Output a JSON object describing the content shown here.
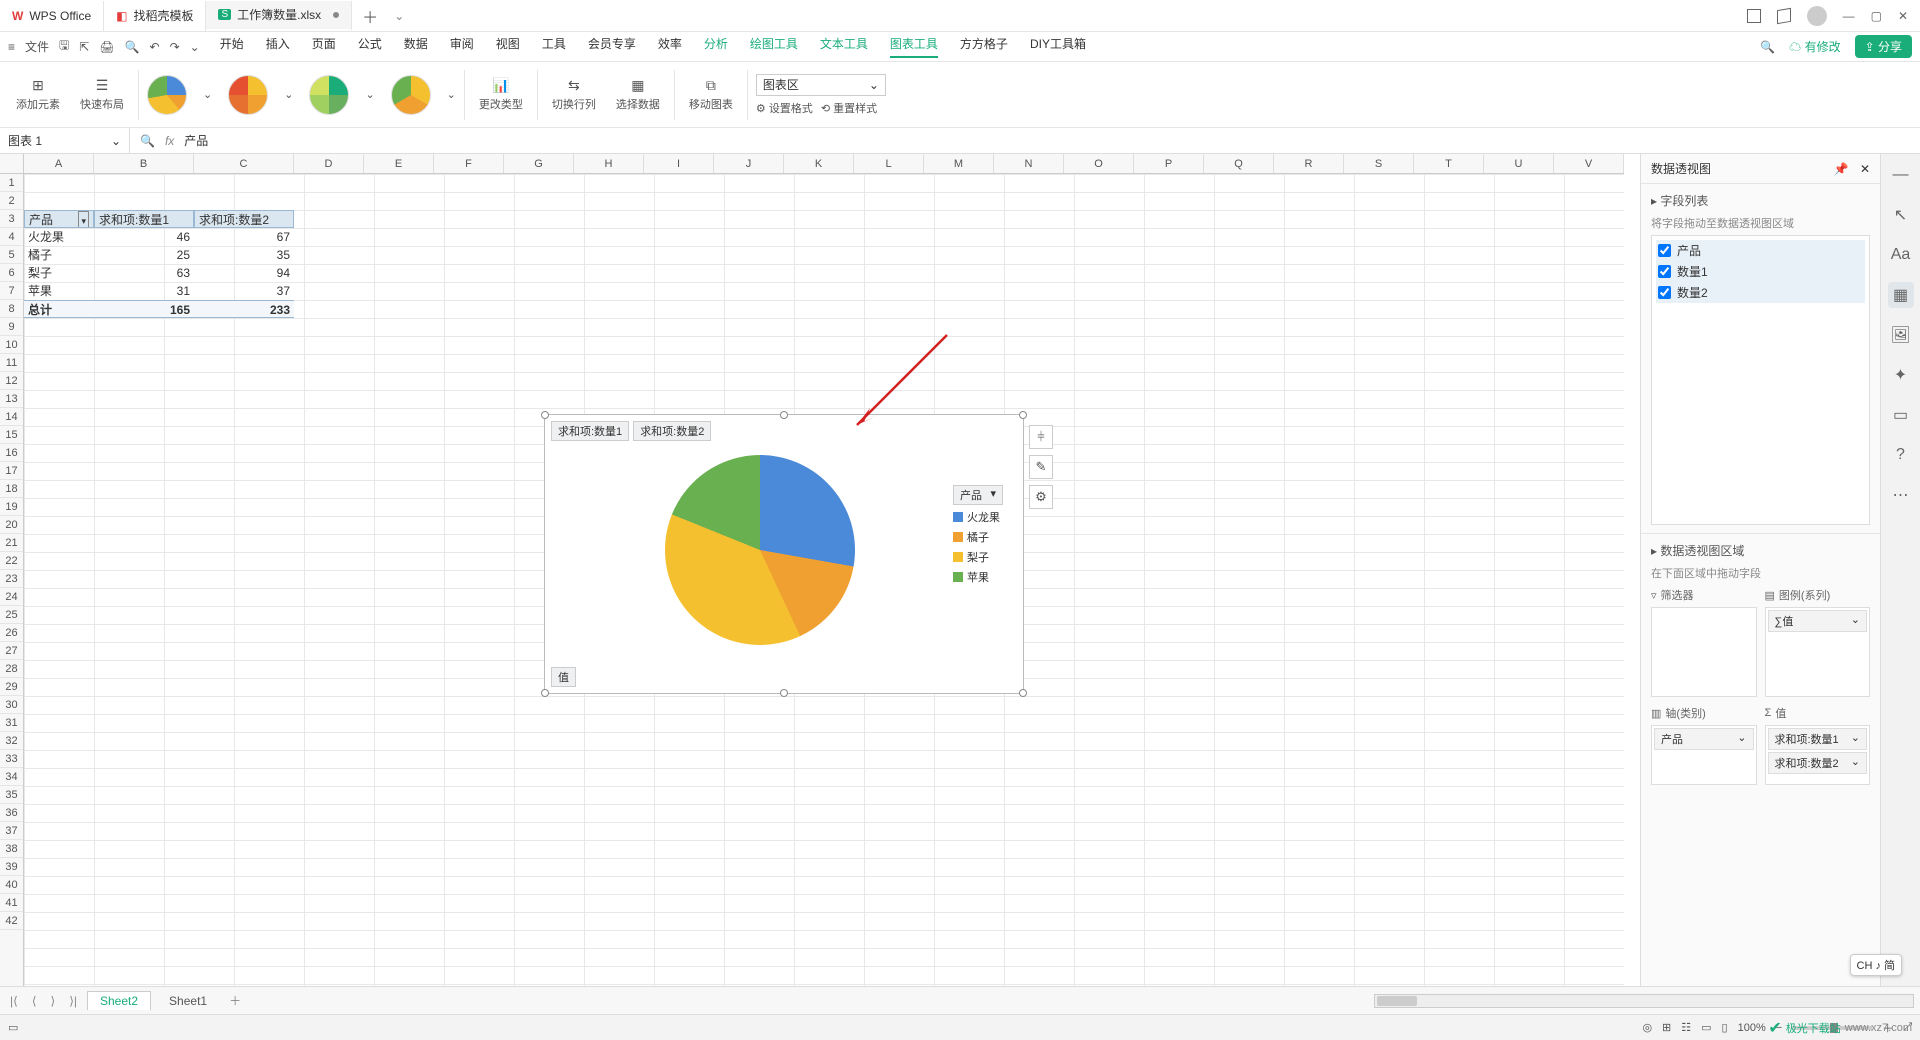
{
  "tabs": {
    "t0": "WPS Office",
    "t1": "找稻壳模板",
    "t2": "工作簿数量.xlsx"
  },
  "menus": {
    "file": "文件",
    "start": "开始",
    "insert": "插入",
    "page": "页面",
    "formula": "公式",
    "data": "数据",
    "review": "审阅",
    "view": "视图",
    "tools": "工具",
    "member": "会员专享",
    "eff": "效率",
    "analyze": "分析",
    "draw": "绘图工具",
    "text": "文本工具",
    "chart": "图表工具",
    "fang": "方方格子",
    "diy": "DIY工具箱"
  },
  "titlebar_right": {
    "modified": "有修改",
    "share": "分享"
  },
  "ribbon": {
    "add_element": "添加元素",
    "quick_layout": "快速布局",
    "change_type": "更改类型",
    "switch": "切换行列",
    "select": "选择数据",
    "move": "移动图表",
    "area_label": "图表区",
    "set_format": "设置格式",
    "reset_style": "重置样式"
  },
  "namebox": "图表 1",
  "formula": "产品",
  "cols": [
    "A",
    "B",
    "C",
    "D",
    "E",
    "F",
    "G",
    "H",
    "I",
    "J",
    "K",
    "L",
    "M",
    "N",
    "O",
    "P",
    "Q",
    "R",
    "S",
    "T",
    "U",
    "V"
  ],
  "table": {
    "h0": "产品",
    "h1": "求和项:数量1",
    "h2": "求和项:数量2",
    "rows": [
      {
        "a": "火龙果",
        "b": "46",
        "c": "67"
      },
      {
        "a": "橘子",
        "b": "25",
        "c": "35"
      },
      {
        "a": "梨子",
        "b": "63",
        "c": "94"
      },
      {
        "a": "苹果",
        "b": "31",
        "c": "37"
      }
    ],
    "total_label": "总计",
    "total_b": "165",
    "total_c": "233"
  },
  "chart": {
    "btn1": "求和项:数量1",
    "btn2": "求和项:数量2",
    "legend_hd": "产品",
    "l1": "火龙果",
    "l2": "橘子",
    "l3": "梨子",
    "l4": "苹果",
    "val": "值"
  },
  "chart_data": {
    "type": "pie",
    "title": "",
    "series_buttons": [
      "求和项:数量1",
      "求和项:数量2"
    ],
    "categories": [
      "火龙果",
      "橘子",
      "梨子",
      "苹果"
    ],
    "series": [
      {
        "name": "求和项:数量1",
        "values": [
          46,
          25,
          63,
          31
        ]
      },
      {
        "name": "求和项:数量2",
        "values": [
          67,
          35,
          94,
          37
        ]
      }
    ],
    "colors": {
      "火龙果": "#4a8ad8",
      "橘子": "#f0a030",
      "梨子": "#f5c030",
      "苹果": "#68b050"
    },
    "legend_position": "right"
  },
  "rpanel": {
    "title": "数据透视图",
    "fields_title": "字段列表",
    "drag_hint": "将字段拖动至数据透视图区域",
    "f1": "产品",
    "f2": "数量1",
    "f3": "数量2",
    "zones_title": "数据透视图区域",
    "zones_hint": "在下面区域中拖动字段",
    "z_filter": "筛选器",
    "z_legend": "图例(系列)",
    "z_axis": "轴(类别)",
    "z_values": "值",
    "tag_sigma": "∑值",
    "tag_prod": "产品",
    "tag_v1": "求和项:数量1",
    "tag_v2": "求和项:数量2"
  },
  "sheets": {
    "s1": "Sheet2",
    "s2": "Sheet1"
  },
  "status": {
    "zoom": "100%"
  },
  "chpin": "CH ♪ 简",
  "watermark": {
    "name": "极光下载站",
    "url": "www.xz7.com"
  }
}
